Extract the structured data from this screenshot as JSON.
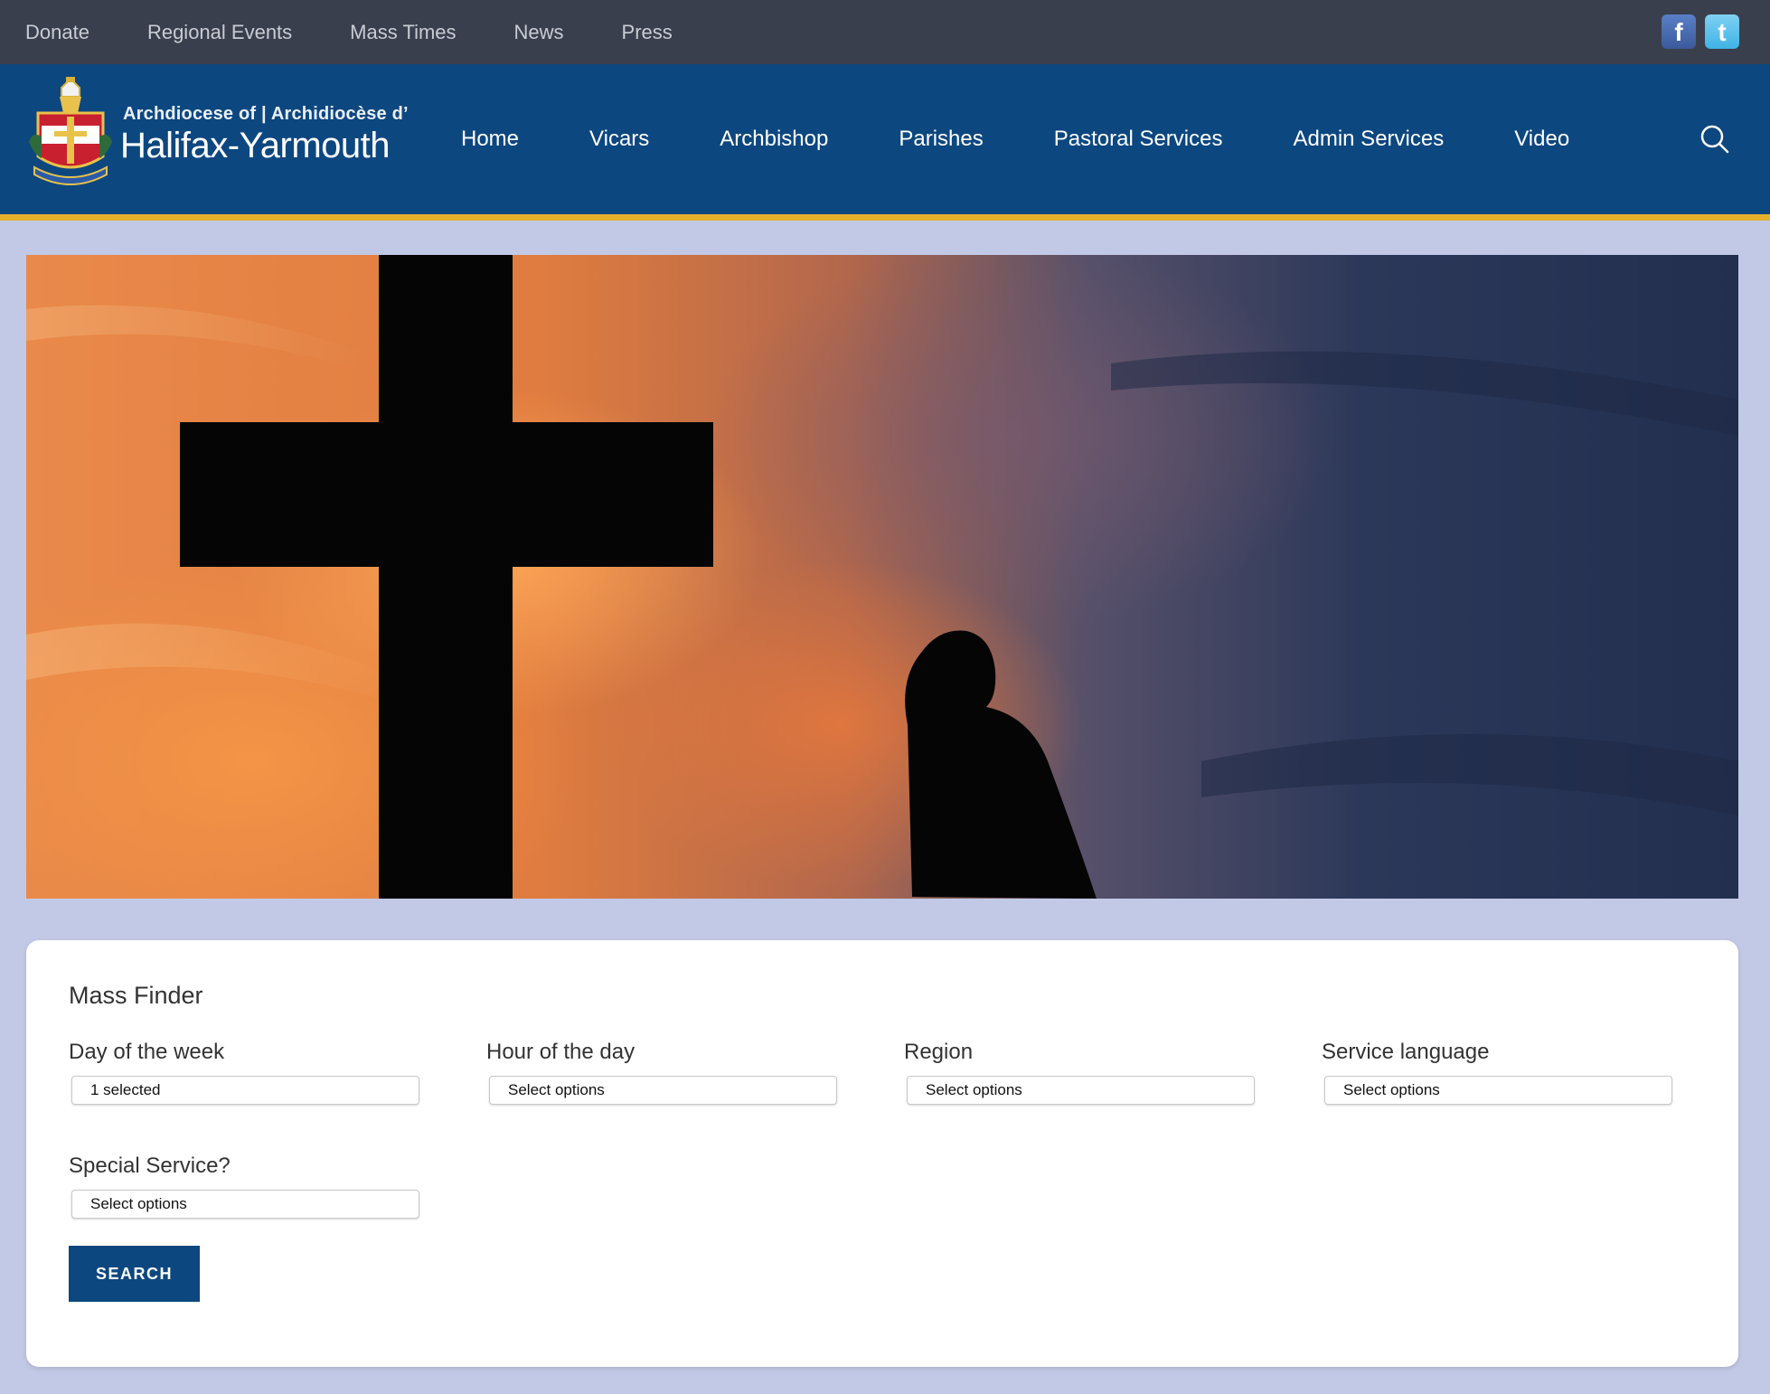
{
  "top_nav": {
    "links": [
      "Donate",
      "Regional Events",
      "Mass Times",
      "News",
      "Press"
    ],
    "social": [
      {
        "icon": "facebook-icon",
        "glyph": "f",
        "color": "#3b5a9a"
      },
      {
        "icon": "twitter-icon",
        "glyph": "t",
        "color": "#3fb3e6"
      }
    ]
  },
  "header": {
    "brand_line1": "Archdiocese of | Archidiocèse d’",
    "brand_line2": "Halifax-Yarmouth",
    "nav": [
      "Home",
      "Vicars",
      "Archbishop",
      "Parishes",
      "Pastoral Services",
      "Admin Services",
      "Video"
    ],
    "accent_color": "#e4b22a",
    "nav_bg": "#0d4780"
  },
  "mass_finder": {
    "title": "Mass Finder",
    "fields": [
      {
        "label": "Day of the week",
        "value": "1 selected"
      },
      {
        "label": "Hour of the day",
        "value": "Select options"
      },
      {
        "label": "Region",
        "value": "Select options"
      },
      {
        "label": "Service language",
        "value": "Select options"
      },
      {
        "label": "Special Service?",
        "value": "Select options"
      }
    ],
    "search_label": "SEARCH"
  }
}
